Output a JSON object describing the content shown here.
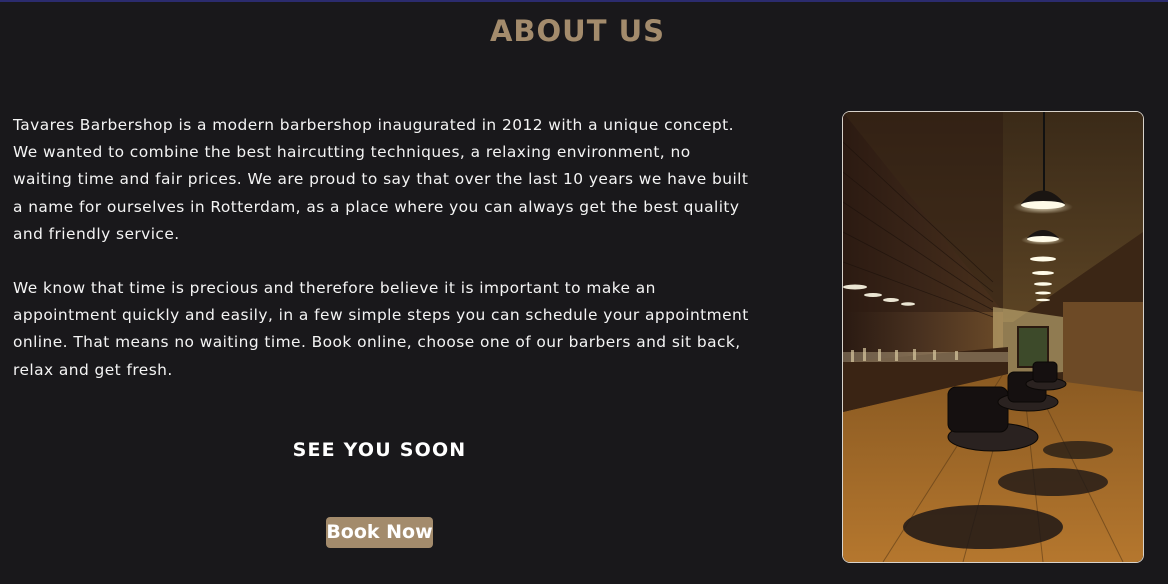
{
  "section": {
    "title": "ABOUT US",
    "paragraphs": [
      "Tavares Barbershop is a modern barbershop inaugurated in 2012 with a unique concept. We wanted to combine the best haircutting techniques, a relaxing environment, no waiting time and fair prices. We are proud to say that over the last 10 years we have built a name for ourselves in Rotterdam, as a place where you can always get the best quality and friendly service.",
      "We know that time is precious and therefore believe it is important to make an appointment quickly and easily, in a few simple steps you can schedule your appointment online. That means no waiting time. Book online, choose one of our barbers and sit back, relax and get fresh."
    ],
    "closing": "SEE YOU SOON",
    "cta_label": "Book Now"
  },
  "image": {
    "alt": "Barbershop interior"
  },
  "colors": {
    "background": "#19181b",
    "accent": "#a38b6c",
    "text": "#f4f4f4"
  }
}
